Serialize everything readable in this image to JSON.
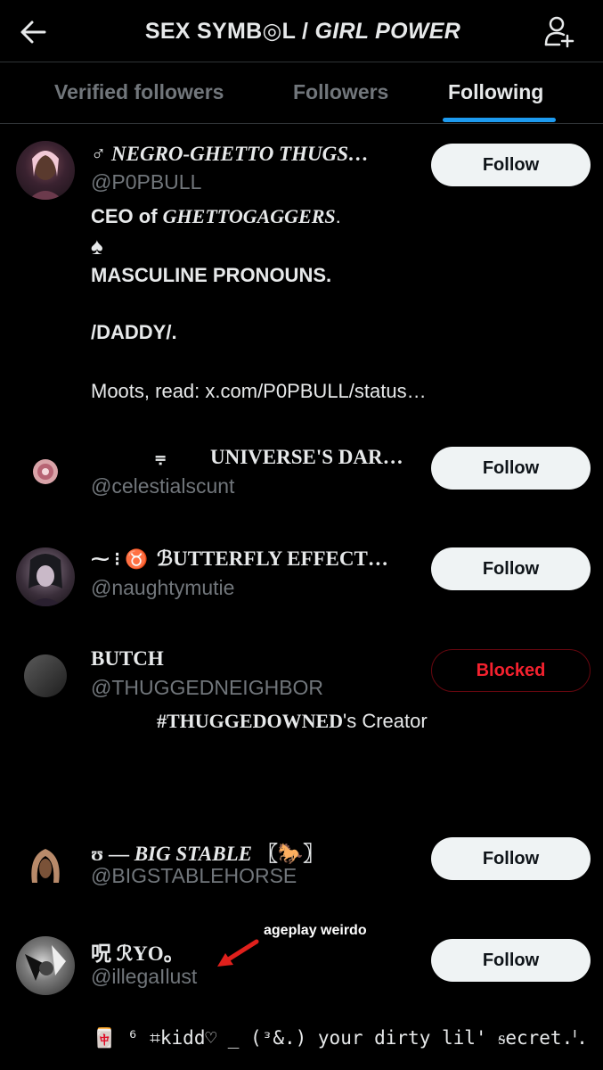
{
  "header": {
    "title_part1": "SEX SYMB◎L",
    "title_sep": " / ",
    "title_part2": "GIRL POWER"
  },
  "tabs": [
    "Verified followers",
    "Followers",
    "Following"
  ],
  "accent_color": "#1d9bf0",
  "users": [
    {
      "name": "♂ NEGRO-GHETTO THUGS…",
      "handle": "@P0PBULL",
      "button": "Follow",
      "bio": {
        "line1_prefix": "CEO of ",
        "line1_name": "GHETTOGAGGERS",
        "line1_suffix": ".",
        "line2": "♠",
        "line3": "MASCULINE PRONOUNS.",
        "line4": "/DADDY/.",
        "line5": "Moots, read: x.com/P0PBULL/status…"
      }
    },
    {
      "name_prefix": "⩦",
      "name": "UNIVERSE'S DAR…",
      "handle": "@celestialscunt",
      "button": "Follow"
    },
    {
      "name_prefix": "⁓ ⁝ ♉",
      "name": "ℬUTTERFLY EFFECT…",
      "handle": "@naughtymutie",
      "button": "Follow"
    },
    {
      "name": "BUTCH",
      "handle": "@THUGGEDNEIGHBOR",
      "button": "Blocked",
      "bio_bold": "#THUGGEDOWNED",
      "bio_rest": "'s Creator"
    },
    {
      "name_prefix": "ʊ — ",
      "name": "BIG STABLE",
      "name_suffix": " 〖🐎〗",
      "handle": "@BIGSTABLEHORSE",
      "button": "Follow"
    },
    {
      "name": "呪 ℛYO。",
      "handle": "@illegaIlust",
      "button": "Follow",
      "bio": "🀄 ⁶ ⌗kidd♡ ̲ (ᵌ&.) your dirty lil' ᵴecret.ᑊ."
    }
  ],
  "annotation": {
    "text": "ageplay weirdo",
    "arrow_color": "#e0201c"
  }
}
